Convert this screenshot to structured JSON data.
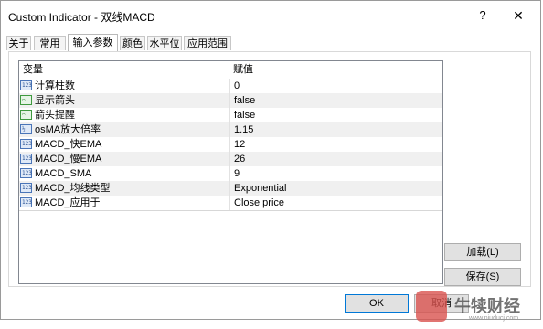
{
  "window": {
    "title": "Custom Indicator - 双线MACD",
    "help": "?",
    "close": "✕"
  },
  "tabs": [
    {
      "label": "关于"
    },
    {
      "label": "常用"
    },
    {
      "label": "输入参数"
    },
    {
      "label": "颜色"
    },
    {
      "label": "水平位"
    },
    {
      "label": "应用范围"
    }
  ],
  "active_tab": "输入参数",
  "grid": {
    "headers": {
      "name": "变量",
      "value": "赋值"
    },
    "rows": [
      {
        "icon": "123",
        "name": "计算柱数",
        "value": "0"
      },
      {
        "icon": "bool",
        "name": "显示箭头",
        "value": "false"
      },
      {
        "icon": "bool",
        "name": "箭头提醒",
        "value": "false"
      },
      {
        "icon": "1/2",
        "name": "osMA放大倍率",
        "value": "1.15"
      },
      {
        "icon": "123",
        "name": "MACD_快EMA",
        "value": "12"
      },
      {
        "icon": "123",
        "name": "MACD_慢EMA",
        "value": "26"
      },
      {
        "icon": "123",
        "name": "MACD_SMA",
        "value": "9"
      },
      {
        "icon": "123",
        "name": "MACD_均线类型",
        "value": "Exponential"
      },
      {
        "icon": "123",
        "name": "MACD_应用于",
        "value": "Close price"
      }
    ]
  },
  "buttons": {
    "load": "加载(L)",
    "save": "保存(S)",
    "ok": "OK",
    "cancel": "取消"
  },
  "watermark": {
    "text": "牛犊财经",
    "sub": "www.niuducj.com"
  }
}
